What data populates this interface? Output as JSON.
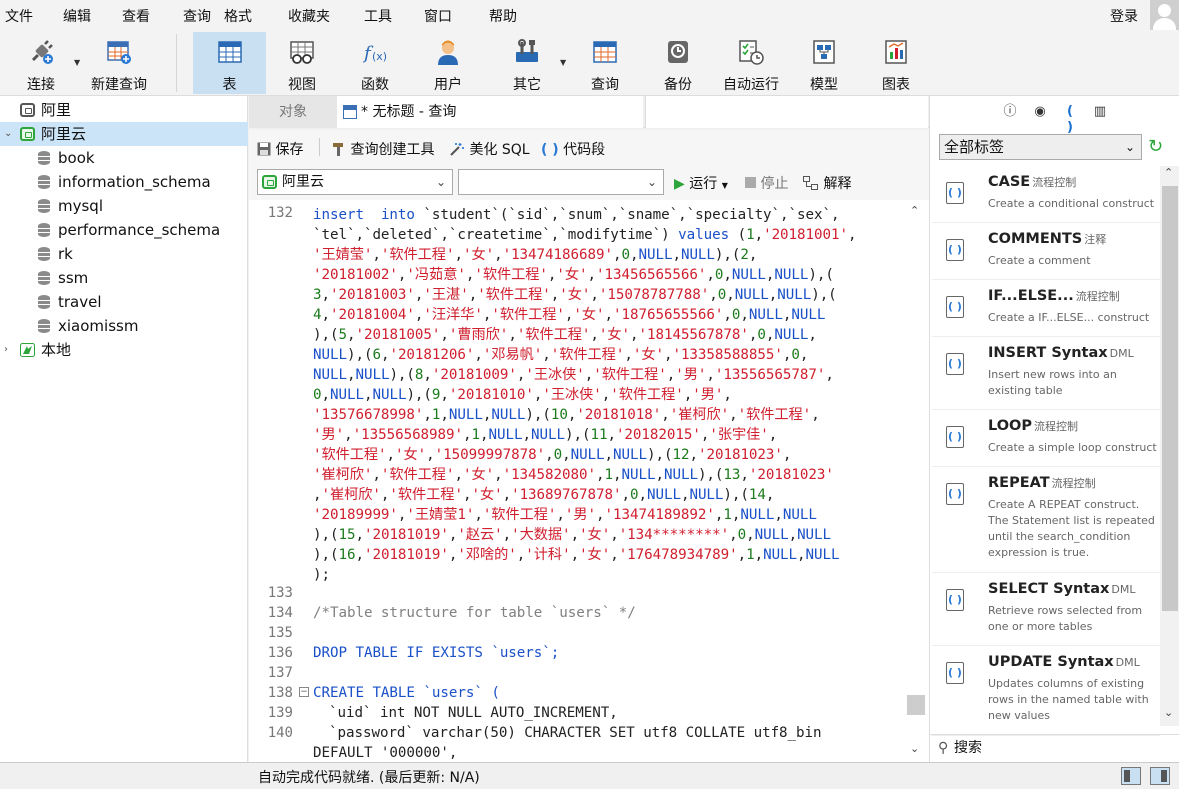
{
  "menu": {
    "items": [
      "文件",
      "编辑",
      "查看",
      "查询",
      "格式",
      "收藏夹",
      "工具",
      "窗口",
      "帮助"
    ],
    "login": "登录"
  },
  "toolbar": {
    "items": [
      {
        "label": "连接",
        "icon": "plug-icon"
      },
      {
        "label": "新建查询",
        "icon": "new-query-icon"
      },
      {
        "label": "表",
        "icon": "table-icon"
      },
      {
        "label": "视图",
        "icon": "view-icon"
      },
      {
        "label": "函数",
        "icon": "function-icon"
      },
      {
        "label": "用户",
        "icon": "user-icon"
      },
      {
        "label": "其它",
        "icon": "tools-icon"
      },
      {
        "label": "查询",
        "icon": "query-icon"
      },
      {
        "label": "备份",
        "icon": "backup-icon"
      },
      {
        "label": "自动运行",
        "icon": "schedule-icon"
      },
      {
        "label": "模型",
        "icon": "model-icon"
      },
      {
        "label": "图表",
        "icon": "chart-icon"
      }
    ]
  },
  "tree": {
    "connections": [
      {
        "name": "阿里",
        "status": "closed"
      },
      {
        "name": "阿里云",
        "status": "open"
      },
      {
        "name": "本地",
        "status": "closed"
      }
    ],
    "databases": [
      "book",
      "information_schema",
      "mysql",
      "performance_schema",
      "rk",
      "ssm",
      "travel",
      "xiaomissm"
    ]
  },
  "tabs": {
    "object": "对象",
    "query": "* 无标题 - 查询"
  },
  "query_toolbar": {
    "save": "保存",
    "builder": "查询创建工具",
    "beautify": "美化 SQL",
    "snippet": "代码段"
  },
  "sql_bar": {
    "connection": "阿里云",
    "database": "",
    "run": "运行",
    "stop": "停止",
    "explain": "解释"
  },
  "editor": {
    "line_numbers": [
      "132",
      "133",
      "134",
      "135",
      "136",
      "137",
      "138",
      "139",
      "140"
    ],
    "comment": "/*Table structure for table `users` */",
    "drop": "DROP TABLE IF EXISTS `users`;",
    "create": "CREATE TABLE `users` (",
    "col_uid": "`uid` int NOT NULL AUTO_INCREMENT,",
    "col_password": "`password` varchar(50) CHARACTER SET utf8 COLLATE utf8_bin",
    "col_default": "DEFAULT '000000',"
  },
  "right_panel": {
    "filter": "全部标签",
    "search_placeholder": "搜索",
    "snippets": [
      {
        "title": "CASE",
        "tag": "流程控制",
        "desc": "Create a conditional construct"
      },
      {
        "title": "COMMENTS",
        "tag": "注释",
        "desc": "Create a comment"
      },
      {
        "title": "IF...ELSE...",
        "tag": "流程控制",
        "desc": "Create a IF...ELSE... construct"
      },
      {
        "title": "INSERT Syntax",
        "tag": "DML",
        "desc": "Insert new rows into an existing table"
      },
      {
        "title": "LOOP",
        "tag": "流程控制",
        "desc": "Create a simple loop construct"
      },
      {
        "title": "REPEAT",
        "tag": "流程控制",
        "desc": "Create A REPEAT construct. The Statement list is repeated until the search_condition expression is true."
      },
      {
        "title": "SELECT Syntax",
        "tag": "DML",
        "desc": "Retrieve rows selected from one or more tables"
      },
      {
        "title": "UPDATE Syntax",
        "tag": "DML",
        "desc": "Updates columns of existing rows in the named table with new values"
      }
    ]
  },
  "status": {
    "text": "自动完成代码就绪. (最后更新: N/A)"
  },
  "colors": {
    "accent": "#c9dff2",
    "selection": "#cce4f7",
    "keyword": "#1a50c8",
    "string": "#d01f2e",
    "number": "#1c7b1c",
    "comment": "#808080",
    "connection_green": "#2ca53a"
  }
}
